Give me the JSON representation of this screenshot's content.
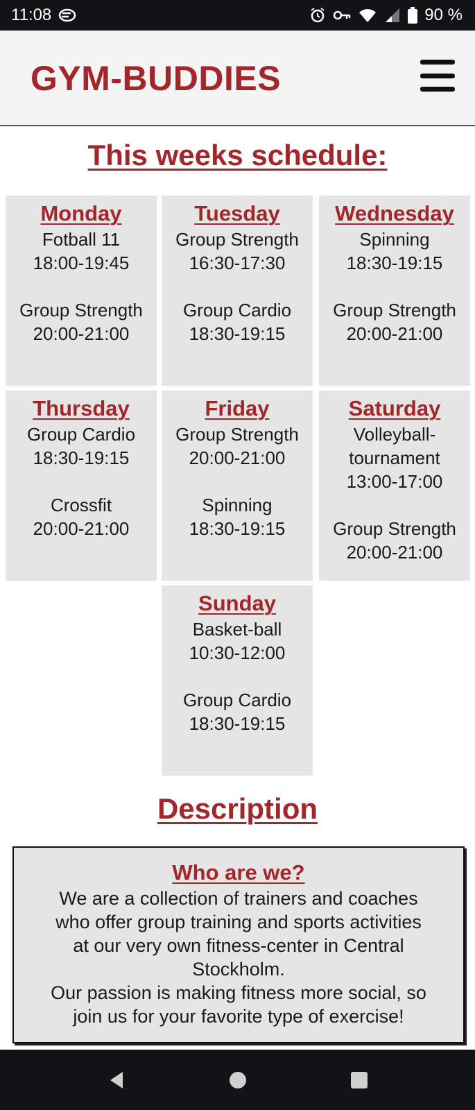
{
  "status_bar": {
    "time": "11:08",
    "battery": "90 %",
    "icons": [
      "cast-icon",
      "alarm-icon",
      "vpn-key-icon",
      "wifi-icon",
      "signal-icon",
      "battery-icon"
    ]
  },
  "header": {
    "logo": "GYM-BUDDIES",
    "menu_icon": "hamburger-menu-icon"
  },
  "schedule": {
    "title": "This weeks schedule:",
    "days": [
      {
        "name": "Monday",
        "lines": [
          "Fotball 11",
          "18:00-19:45",
          "",
          "Group Strength",
          "20:00-21:00"
        ]
      },
      {
        "name": "Tuesday",
        "lines": [
          "Group Strength",
          "16:30-17:30",
          "",
          "Group Cardio",
          "18:30-19:15"
        ]
      },
      {
        "name": "Wednesday",
        "lines": [
          "Spinning",
          "18:30-19:15",
          "",
          "Group Strength",
          "20:00-21:00"
        ]
      },
      {
        "name": "Thursday",
        "lines": [
          "Group Cardio",
          "18:30-19:15",
          "",
          "Crossfit",
          "20:00-21:00"
        ]
      },
      {
        "name": "Friday",
        "lines": [
          "Group Strength",
          "20:00-21:00",
          "",
          "Spinning",
          "18:30-19:15"
        ]
      },
      {
        "name": "Saturday",
        "lines": [
          "Volleyball-",
          "tournament",
          "13:00-17:00",
          "",
          "Group Strength",
          "20:00-21:00"
        ]
      },
      {
        "name": "Sunday",
        "lines": [
          "Basket-ball",
          "10:30-12:00",
          "",
          "Group Cardio",
          "18:30-19:15"
        ]
      }
    ]
  },
  "description": {
    "title": "Description",
    "heading": "Who are we?",
    "lines": [
      "We are a collection of trainers and coaches",
      "who offer group training and sports activities",
      "at our very own fitness-center in Central",
      "Stockholm.",
      "Our passion is making fitness more social, so",
      "join us for your favorite type of exercise!"
    ]
  },
  "nav_bar": {
    "buttons": [
      "back-icon",
      "home-icon",
      "recents-icon"
    ]
  },
  "colors": {
    "brand": "#a3262a",
    "box_bg": "#e5e5e5",
    "header_bg": "#f4f4f4",
    "system_bar": "#111316"
  }
}
